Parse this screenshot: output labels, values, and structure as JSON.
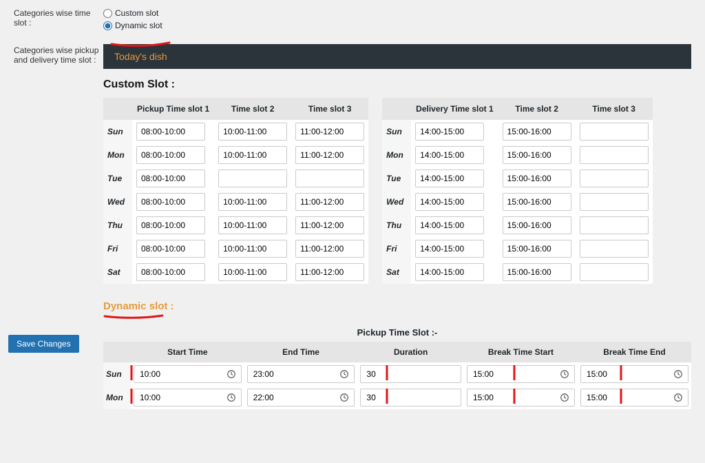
{
  "labels": {
    "categories_time_slot": "Categories wise time slot :",
    "categories_pickup_delivery": "Categories wise pickup and delivery time slot :",
    "radio_custom": "Custom slot",
    "radio_dynamic": "Dynamic slot",
    "tab_title": "Today's dish",
    "custom_slot_heading": "Custom Slot :",
    "pickup_slot1": "Pickup Time slot 1",
    "time_slot2": "Time slot 2",
    "time_slot3": "Time slot 3",
    "delivery_slot1": "Delivery Time slot 1",
    "dynamic_slot_heading": "Dynamic slot :",
    "pickup_time_slot_heading": "Pickup Time Slot :-",
    "start_time": "Start Time",
    "end_time": "End Time",
    "duration": "Duration",
    "break_start": "Break Time Start",
    "break_end": "Break Time End",
    "save": "Save Changes"
  },
  "radio_selected": "dynamic",
  "days": [
    "Sun",
    "Mon",
    "Tue",
    "Wed",
    "Thu",
    "Fri",
    "Sat"
  ],
  "custom_pickup": [
    {
      "s1": "08:00-10:00",
      "s2": "10:00-11:00",
      "s3": "11:00-12:00"
    },
    {
      "s1": "08:00-10:00",
      "s2": "10:00-11:00",
      "s3": "11:00-12:00"
    },
    {
      "s1": "08:00-10:00",
      "s2": "",
      "s3": ""
    },
    {
      "s1": "08:00-10:00",
      "s2": "10:00-11:00",
      "s3": "11:00-12:00"
    },
    {
      "s1": "08:00-10:00",
      "s2": "10:00-11:00",
      "s3": "11:00-12:00"
    },
    {
      "s1": "08:00-10:00",
      "s2": "10:00-11:00",
      "s3": "11:00-12:00"
    },
    {
      "s1": "08:00-10:00",
      "s2": "10:00-11:00",
      "s3": "11:00-12:00"
    }
  ],
  "custom_delivery": [
    {
      "s1": "14:00-15:00",
      "s2": "15:00-16:00",
      "s3": ""
    },
    {
      "s1": "14:00-15:00",
      "s2": "15:00-16:00",
      "s3": ""
    },
    {
      "s1": "14:00-15:00",
      "s2": "15:00-16:00",
      "s3": ""
    },
    {
      "s1": "14:00-15:00",
      "s2": "15:00-16:00",
      "s3": ""
    },
    {
      "s1": "14:00-15:00",
      "s2": "15:00-16:00",
      "s3": ""
    },
    {
      "s1": "14:00-15:00",
      "s2": "15:00-16:00",
      "s3": ""
    },
    {
      "s1": "14:00-15:00",
      "s2": "15:00-16:00",
      "s3": ""
    }
  ],
  "dynamic_rows": [
    {
      "day": "Sun",
      "start": "10:00",
      "end": "23:00",
      "duration": "30",
      "break_start": "15:00",
      "break_end": "15:00"
    },
    {
      "day": "Mon",
      "start": "10:00",
      "end": "22:00",
      "duration": "30",
      "break_start": "15:00",
      "break_end": "15:00"
    }
  ]
}
